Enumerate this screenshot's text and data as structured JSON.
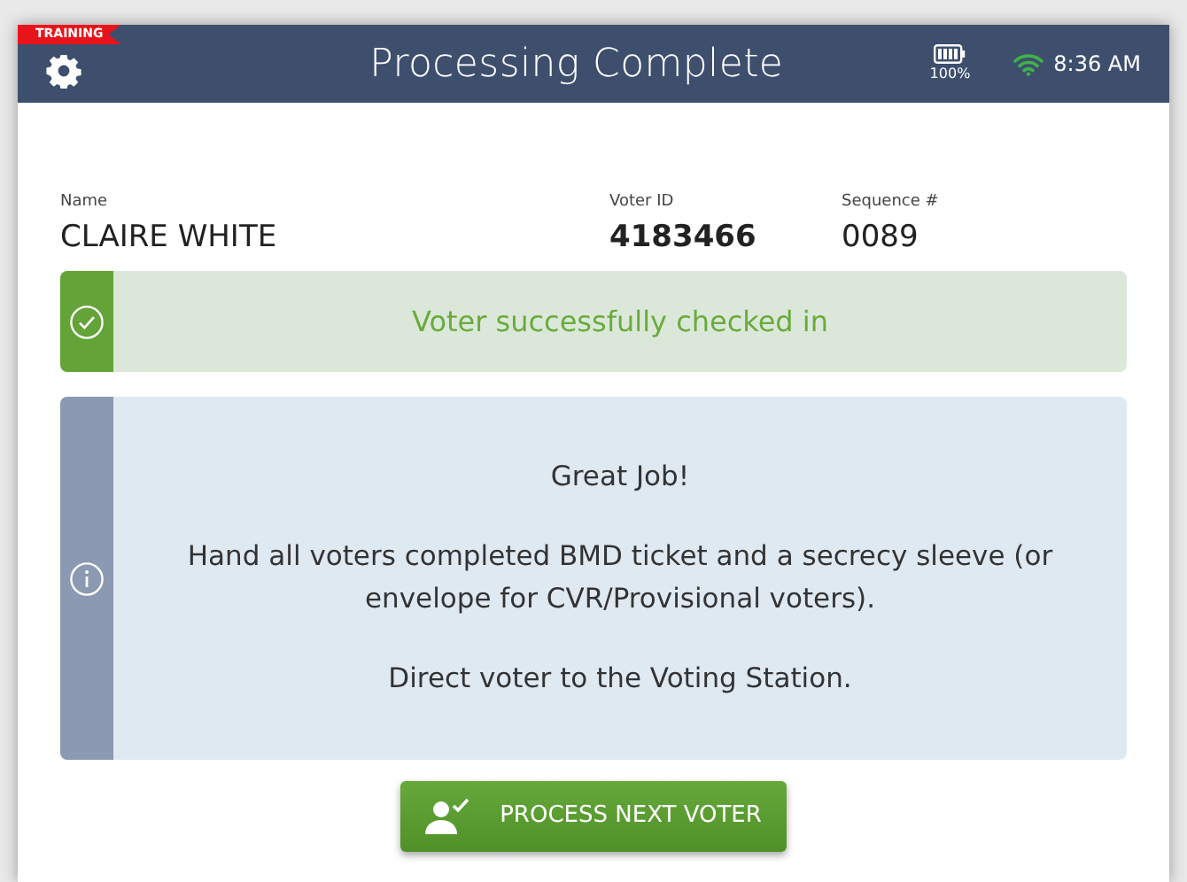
{
  "header": {
    "badge": "TRAINING",
    "title": "Processing Complete",
    "battery": "100%",
    "time": "8:36 AM"
  },
  "voter": {
    "fields": [
      {
        "label": "Name",
        "value": "CLAIRE WHITE"
      },
      {
        "label": "Voter ID",
        "value": "4183466"
      },
      {
        "label": "Sequence #",
        "value": "0089"
      }
    ]
  },
  "alerts": [
    {
      "kind": "success",
      "lines": [
        "Voter successfully checked in"
      ]
    },
    {
      "kind": "info",
      "lines": [
        "Great Job!",
        "Hand all voters completed BMD ticket and a secrecy sleeve (or envelope for CVR/Provisional voters).",
        "Direct voter to the Voting Station."
      ]
    }
  ],
  "button": "PROCESS NEXT VOTER"
}
